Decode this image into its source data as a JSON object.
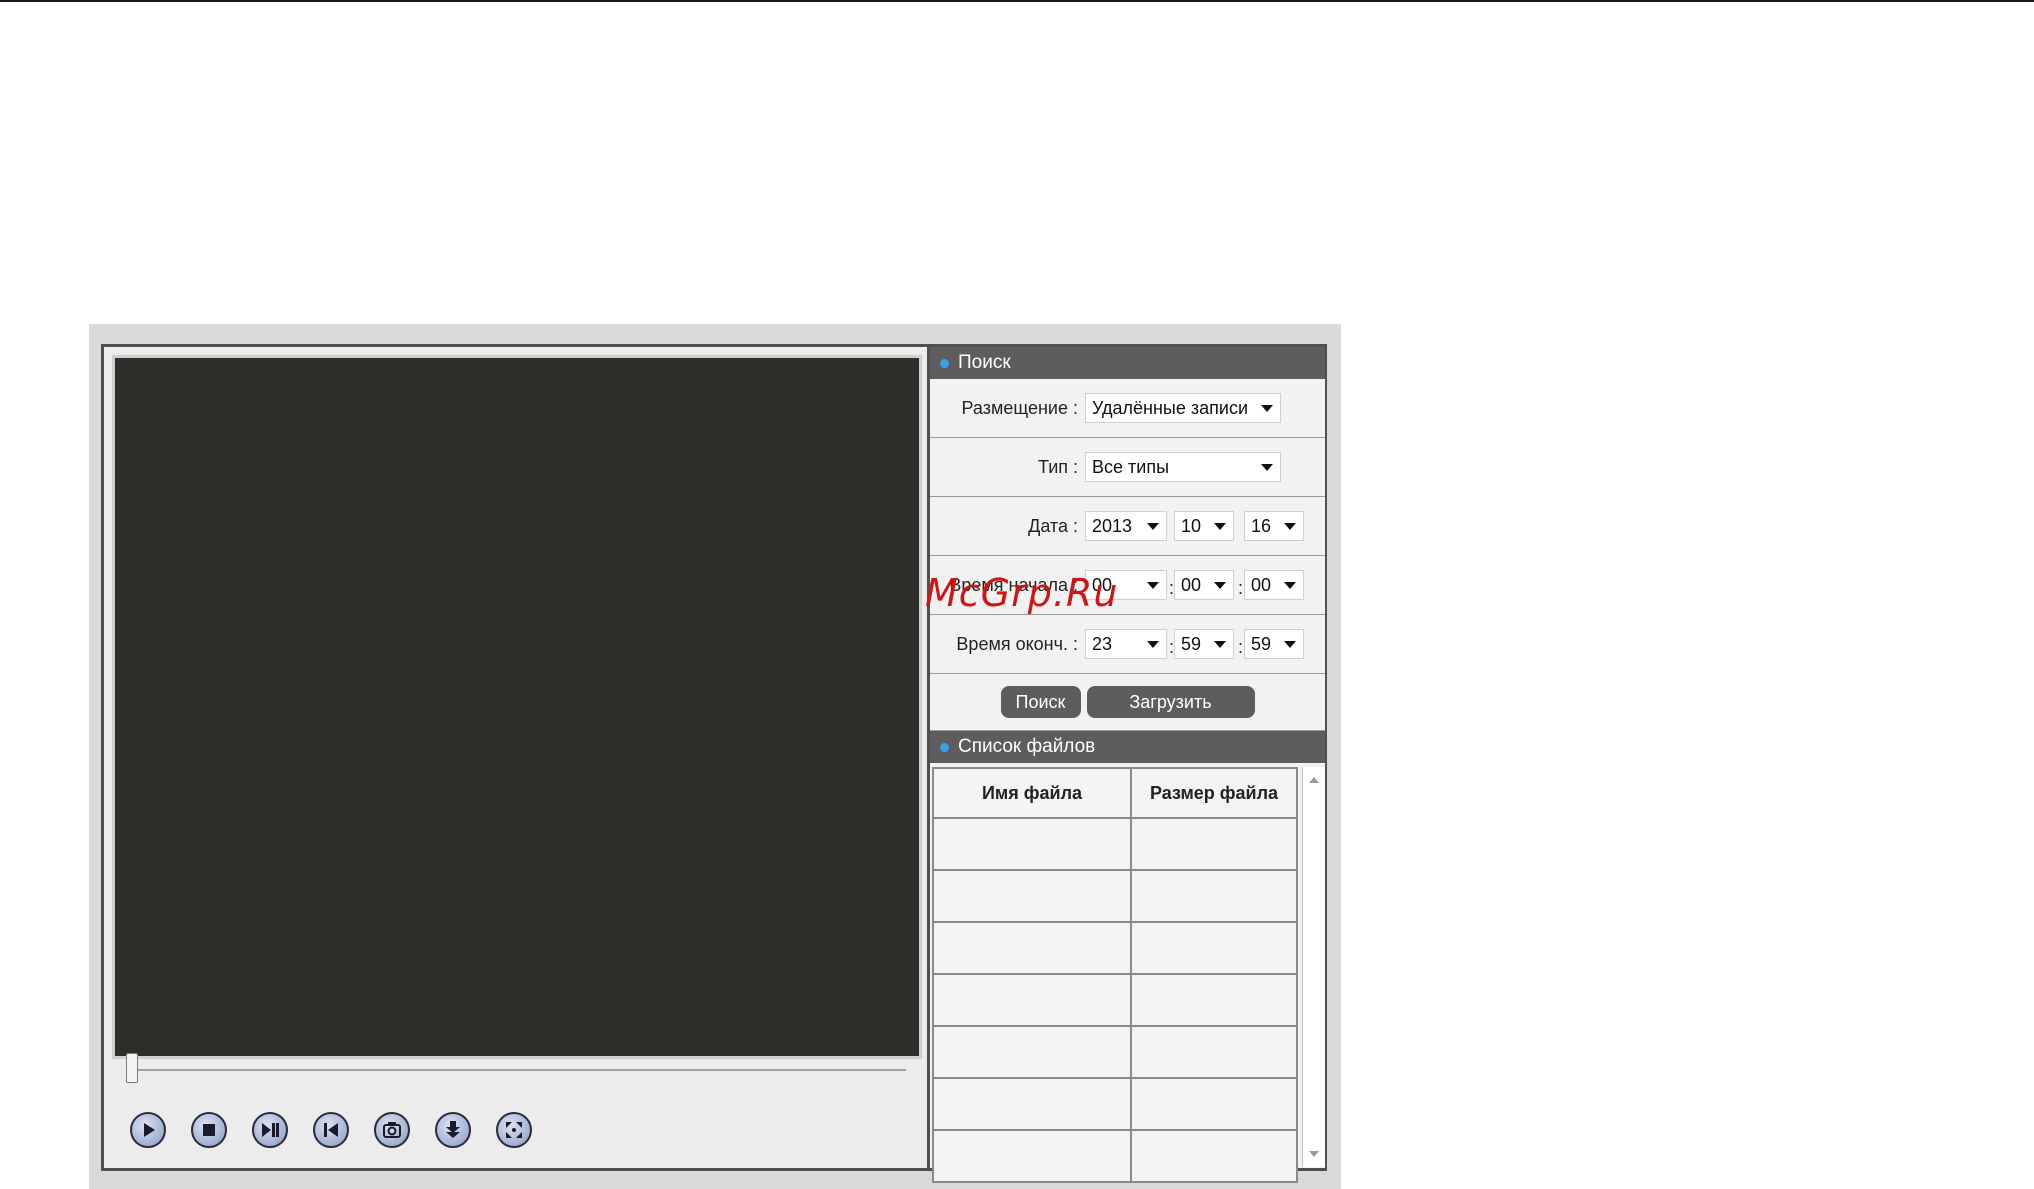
{
  "search": {
    "title": "Поиск",
    "location_label": "Размещение :",
    "location_value": "Удалённые записи",
    "type_label": "Тип :",
    "type_value": "Все типы",
    "date_label": "Дата :",
    "date_year": "2013",
    "date_month": "10",
    "date_day": "16",
    "start_label": "Время начала :",
    "start_h": "00",
    "start_m": "00",
    "start_s": "00",
    "end_label": "Время оконч. :",
    "end_h": "23",
    "end_m": "59",
    "end_s": "59",
    "search_button": "Поиск",
    "download_button": "Загрузить"
  },
  "filelist": {
    "title": "Список файлов",
    "col_name": "Имя файла",
    "col_size": "Размер файла"
  },
  "watermark": "McGrp.Ru",
  "controls": [
    "play-icon",
    "stop-icon",
    "step-forward-icon",
    "skip-back-icon",
    "snapshot-icon",
    "download-icon",
    "fullscreen-icon"
  ],
  "colors": {
    "accent_dot": "#3aa0e8",
    "header_bg": "#5d5d5d",
    "video_bg": "#2e2e2a",
    "watermark": "#d11515"
  }
}
